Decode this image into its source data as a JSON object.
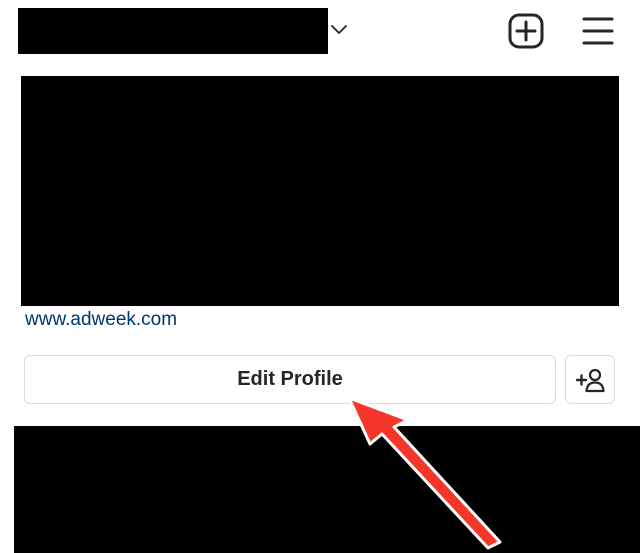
{
  "header": {
    "username_redacted": true,
    "switch_account_icon": "chevron-down-icon",
    "new_post_icon": "plus-square-icon",
    "menu_icon": "hamburger-menu-icon"
  },
  "profile": {
    "bio_redacted": true,
    "website_link": "www.adweek.com",
    "edit_profile_label": "Edit Profile",
    "discover_people_icon": "add-person-icon"
  },
  "annotation": {
    "arrow_color": "#f4372a",
    "target": "edit-profile-button"
  },
  "colors": {
    "link": "#00376b",
    "button_border": "#dbdbdb",
    "button_text": "#262626"
  }
}
